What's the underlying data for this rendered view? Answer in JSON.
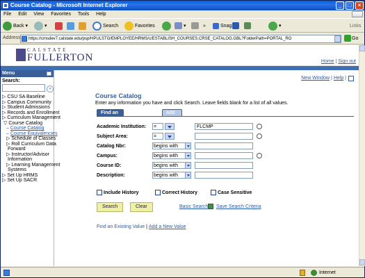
{
  "window": {
    "title": "Course Catalog - Microsoft Internet Explorer"
  },
  "menubar": [
    "File",
    "Edit",
    "View",
    "Favorites",
    "Tools",
    "Help"
  ],
  "toolbar": {
    "back": "Back",
    "search": "Search",
    "favorites": "Favorites",
    "snagit": "SnagIt",
    "links": "Links"
  },
  "address": {
    "label": "Address",
    "url": "https://cmsdev7.calstate.edu/psp/HPULSTG/EMPLOYEE/HRMS/c/ESTABLISH_COURSES.CRSE_CATALOG.GBL?FolderPath=PORTAL_RO",
    "go": "Go"
  },
  "header": {
    "logo_small": "CALSTATE",
    "logo_big": "FULLERTON",
    "home": "Home",
    "signout": "Sign out"
  },
  "menu": {
    "title": "Menu",
    "search_label": "Search:",
    "items": [
      {
        "label": "CSU SA Baseline",
        "kind": "lvl0"
      },
      {
        "label": "Campus Community",
        "kind": "lvl0"
      },
      {
        "label": "Student Admissions",
        "kind": "lvl0"
      },
      {
        "label": "Records and Enrollment",
        "kind": "lvl0"
      },
      {
        "label": "Curriculum Management",
        "kind": "lvl0"
      },
      {
        "label": "Course Catalog",
        "kind": "lvl1"
      },
      {
        "label": "Course Catalog",
        "kind": "lvl2"
      },
      {
        "label": "Course Equivalencies",
        "kind": "lvl2"
      },
      {
        "label": "Schedule of Classes",
        "kind": "sub"
      },
      {
        "label": "Roll Curriculum Data",
        "kind": "sub"
      },
      {
        "label": "Forward",
        "kind": "sub2"
      },
      {
        "label": "Instructor/Advisor",
        "kind": "sub"
      },
      {
        "label": "Information",
        "kind": "sub2"
      },
      {
        "label": "Learning Management",
        "kind": "sub"
      },
      {
        "label": "Systems",
        "kind": "sub2"
      },
      {
        "label": "Set Up HRMS",
        "kind": "lvl0"
      },
      {
        "label": "Set Up SACR",
        "kind": "lvl0"
      }
    ]
  },
  "main": {
    "new_window": "New Window",
    "help": "Help",
    "title": "Course Catalog",
    "instructions": "Enter any information you have and click Search. Leave fields blank for a list of all values.",
    "tab_find": "Find an Existing Value",
    "tab_add": "Add a New Value",
    "fields": [
      {
        "label": "Academic Institution:",
        "op": "=",
        "value": "FLCMP"
      },
      {
        "label": "Subject Area:",
        "op": "=",
        "value": ""
      },
      {
        "label": "Catalog Nbr:",
        "op": "begins with",
        "value": ""
      },
      {
        "label": "Campus:",
        "op": "begins with",
        "value": ""
      },
      {
        "label": "Course ID:",
        "op": "begins with",
        "value": ""
      },
      {
        "label": "Description:",
        "op": "begins with",
        "value": ""
      }
    ],
    "checks": [
      "Include History",
      "Correct History",
      "Case Sensitive"
    ],
    "search_btn": "Search",
    "clear_btn": "Clear",
    "basic_search": "Basic Search",
    "save_search": "Save Search Criteria",
    "bottom_find": "Find an Existing Value",
    "bottom_add": "Add a New Value"
  },
  "status": {
    "zone": "Internet"
  }
}
